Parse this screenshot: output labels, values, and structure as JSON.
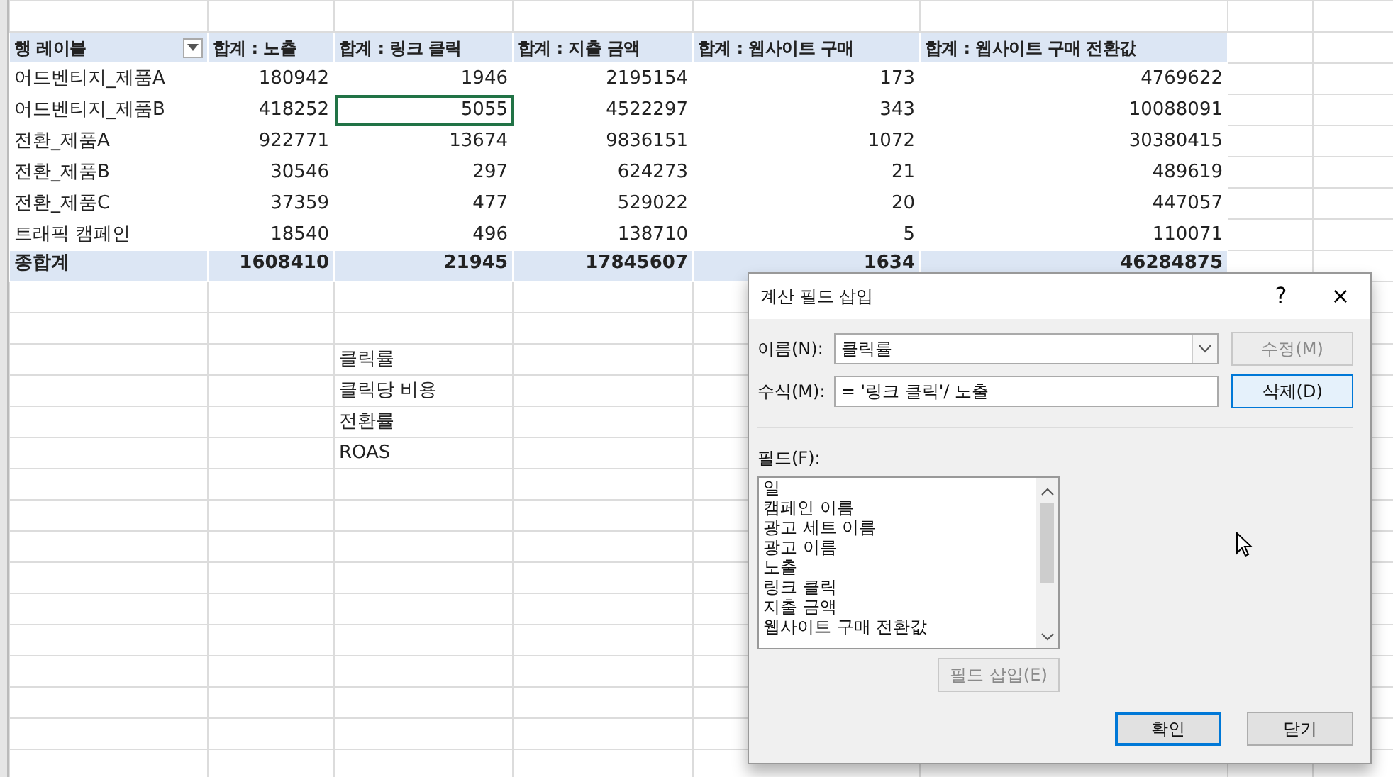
{
  "pivot": {
    "columns": [
      {
        "label": "행 레이블",
        "filter": true
      },
      {
        "label": "합계 : 노출",
        "filter": false
      },
      {
        "label": "합계 : 링크 클릭",
        "filter": false
      },
      {
        "label": "합계 : 지출 금액",
        "filter": false
      },
      {
        "label": "합계 : 웹사이트 구매",
        "filter": false
      },
      {
        "label": "합계 : 웹사이트 구매 전환값",
        "filter": false
      }
    ],
    "rows": [
      {
        "label": "어드벤티지_제품A",
        "values": [
          {
            "text": "180942",
            "selected": false
          },
          {
            "text": "1946",
            "selected": false
          },
          {
            "text": "2195154",
            "selected": false
          },
          {
            "text": "173",
            "selected": false
          },
          {
            "text": "4769622",
            "selected": false
          }
        ]
      },
      {
        "label": "어드벤티지_제품B",
        "values": [
          {
            "text": "418252",
            "selected": false
          },
          {
            "text": "5055",
            "selected": true
          },
          {
            "text": "4522297",
            "selected": false
          },
          {
            "text": "343",
            "selected": false
          },
          {
            "text": "10088091",
            "selected": false
          }
        ]
      },
      {
        "label": "전환_제품A",
        "values": [
          {
            "text": "922771",
            "selected": false
          },
          {
            "text": "13674",
            "selected": false
          },
          {
            "text": "9836151",
            "selected": false
          },
          {
            "text": "1072",
            "selected": false
          },
          {
            "text": "30380415",
            "selected": false
          }
        ]
      },
      {
        "label": "전환_제품B",
        "values": [
          {
            "text": "30546",
            "selected": false
          },
          {
            "text": "297",
            "selected": false
          },
          {
            "text": "624273",
            "selected": false
          },
          {
            "text": "21",
            "selected": false
          },
          {
            "text": "489619",
            "selected": false
          }
        ]
      },
      {
        "label": "전환_제품C",
        "values": [
          {
            "text": "37359",
            "selected": false
          },
          {
            "text": "477",
            "selected": false
          },
          {
            "text": "529022",
            "selected": false
          },
          {
            "text": "20",
            "selected": false
          },
          {
            "text": "447057",
            "selected": false
          }
        ]
      },
      {
        "label": "트래픽 캠페인",
        "values": [
          {
            "text": "18540",
            "selected": false
          },
          {
            "text": "496",
            "selected": false
          },
          {
            "text": "138710",
            "selected": false
          },
          {
            "text": "5",
            "selected": false
          },
          {
            "text": "110071",
            "selected": false
          }
        ]
      }
    ],
    "total": {
      "label": "종합계",
      "values": [
        "1608410",
        "21945",
        "17845607",
        "1634",
        "46284875"
      ]
    }
  },
  "notes": [
    "클릭률",
    "클릭당 비용",
    "전환률",
    "ROAS"
  ],
  "dialog": {
    "title": "계산 필드 삽입",
    "help": "?",
    "close": "×",
    "name_label": "이름(N):",
    "name_value": "클릭률",
    "formula_label": "수식(M):",
    "formula_value": "= '링크 클릭'/ 노출",
    "side_buttons": [
      {
        "label": "수정(M)",
        "disabled": true,
        "hover": false,
        "default": false
      },
      {
        "label": "삭제(D)",
        "disabled": false,
        "hover": true,
        "default": false
      }
    ],
    "fields_label": "필드(F):",
    "fields": [
      "일",
      "캠페인 이름",
      "광고 세트 이름",
      "광고 이름",
      "노출",
      "링크 클릭",
      "지출 금액",
      "웹사이트 구매 전환값"
    ],
    "insert_button": {
      "label": "필드 삽입(E)",
      "disabled": true,
      "hover": false,
      "default": false
    },
    "buttons": [
      {
        "label": "확인",
        "disabled": false,
        "hover": false,
        "default": true
      },
      {
        "label": "닫기",
        "disabled": false,
        "hover": false,
        "default": false
      }
    ]
  }
}
